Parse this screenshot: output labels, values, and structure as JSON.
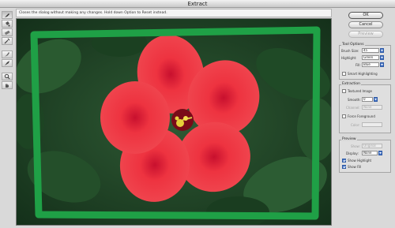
{
  "window": {
    "title": "Extract"
  },
  "hint": {
    "text": "Closes the dialog without making any changes. Hold down Option to Reset instead."
  },
  "tools": [
    {
      "name": "edge-highlighter-icon"
    },
    {
      "name": "fill-icon"
    },
    {
      "name": "eraser-icon"
    },
    {
      "name": "eyedropper-icon"
    },
    {
      "name": "cleanup-icon"
    },
    {
      "name": "edge-touchup-icon"
    },
    {
      "name": "zoom-icon"
    },
    {
      "name": "hand-icon"
    }
  ],
  "buttons": {
    "ok": "OK",
    "cancel": "Cancel",
    "preview": "Preview"
  },
  "tool_options": {
    "title": "Tool Options",
    "brush_size_label": "Brush Size:",
    "brush_size_value": "45",
    "highlight_label": "Highlight:",
    "highlight_value": "Green",
    "fill_label": "Fill:",
    "fill_value": "Blue",
    "smart_highlighting_label": "Smart Highlighting"
  },
  "extraction": {
    "title": "Extraction",
    "textured_image_label": "Textured Image",
    "smooth_label": "Smooth:",
    "smooth_value": "0",
    "channel_label": "Channel:",
    "channel_value": "None",
    "force_foreground_label": "Force Foreground",
    "color_label": "Color:"
  },
  "preview": {
    "title": "Preview",
    "show_label": "Show:",
    "show_value": "Original",
    "display_label": "Display:",
    "display_value": "None",
    "show_highlight_label": "Show Highlight",
    "show_fill_label": "Show Fill"
  },
  "colors": {
    "highlight": "#1fa046",
    "flower": "#e8323a",
    "accent": "#4a78c8"
  }
}
